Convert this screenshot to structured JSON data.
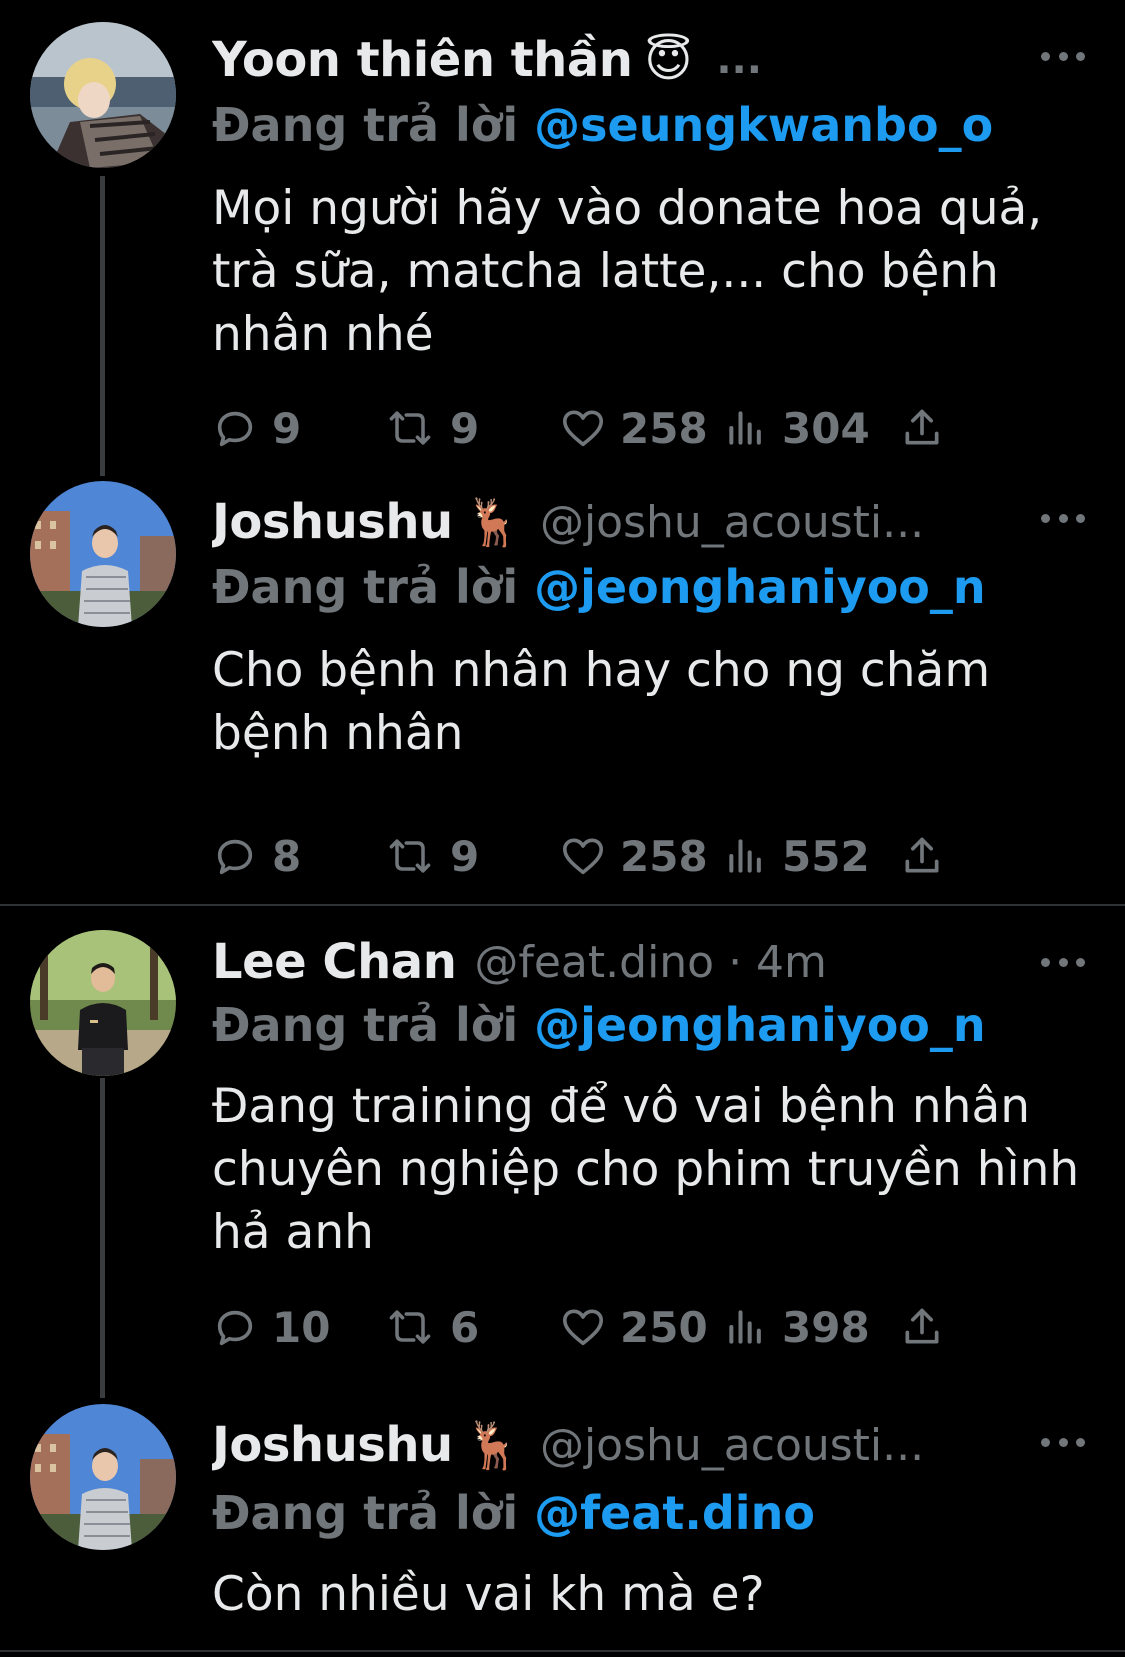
{
  "reply_prefix": "Đang trả lời",
  "tweets": [
    {
      "name": "Yoon thiên thần",
      "emoji": "😇",
      "handle": "",
      "trailing": "...",
      "reply_to": "@seungkwanbo_o",
      "text": "Mọi người hãy vào donate hoa quả, trà sữa, matcha latte,... cho bệnh nhân nhé",
      "replies": "9",
      "retweets": "9",
      "likes": "258",
      "views": "304"
    },
    {
      "name": "Joshushu",
      "emoji": "🦌",
      "handle": "@joshu_acousti...",
      "reply_to": "@jeonghaniyoo_n",
      "text": "Cho bệnh nhân hay cho ng chăm bệnh nhân",
      "replies": "8",
      "retweets": "9",
      "likes": "258",
      "views": "552"
    },
    {
      "name": "Lee Chan",
      "emoji": "",
      "handle": "@feat.dino · 4m",
      "reply_to": "@jeonghaniyoo_n",
      "text": "Đang training để vô vai bệnh nhân chuyên nghiệp cho phim truyền hình hả anh",
      "replies": "10",
      "retweets": "6",
      "likes": "250",
      "views": "398"
    },
    {
      "name": "Joshushu",
      "emoji": "🦌",
      "handle": "@joshu_acousti...",
      "reply_to": "@feat.dino",
      "text": "Còn nhiều vai kh mà e?"
    }
  ],
  "colors": {
    "background": "#000000",
    "text": "#e7e9ea",
    "muted": "#71767b",
    "link": "#1d9bf0",
    "divider": "#2f3336"
  },
  "icons": [
    "reply-icon",
    "retweet-icon",
    "like-icon",
    "views-icon",
    "share-icon",
    "more-icon"
  ]
}
